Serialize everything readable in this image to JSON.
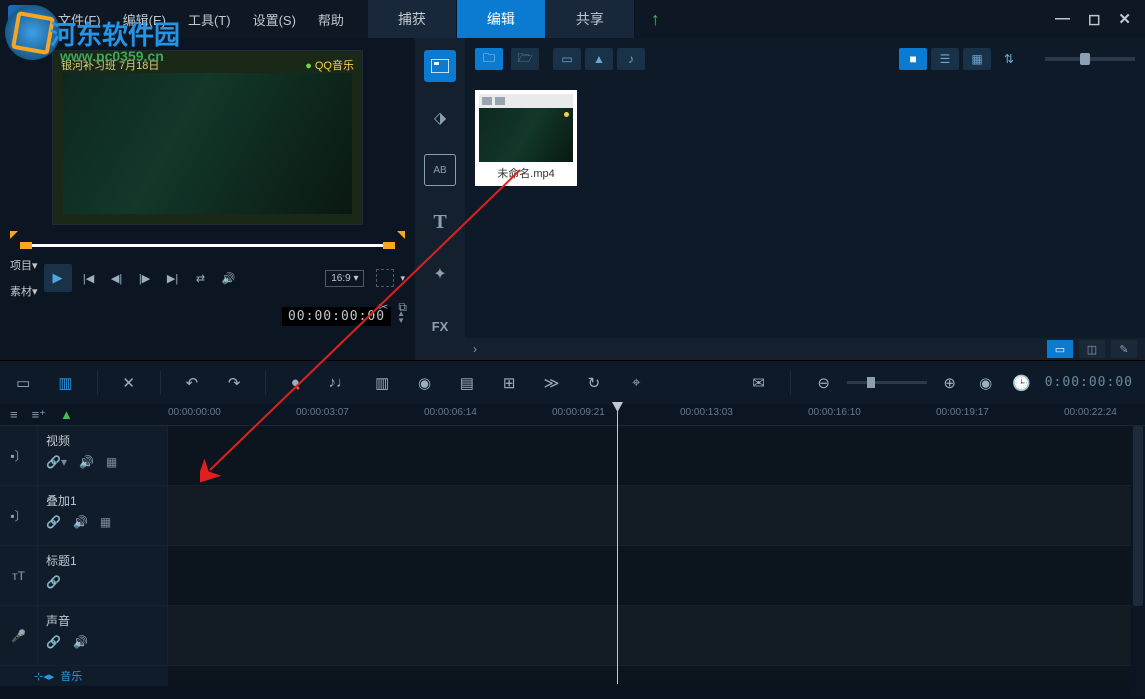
{
  "watermark": {
    "text": "河东软件园",
    "url": "www.pc0359.cn"
  },
  "menu": {
    "file": "文件(F)",
    "edit": "编辑(E)",
    "tools": "工具(T)",
    "settings": "设置(S)",
    "help": "帮助"
  },
  "modes": {
    "capture": "捕获",
    "edit": "编辑",
    "share": "共享"
  },
  "preview": {
    "overlay_text": "银河补习班  7月18日",
    "overlay_music": "QQ音乐",
    "label_project": "项目▾",
    "label_clip": "素材▾",
    "aspect": "16:9 ▾",
    "time": "00:00:00:00"
  },
  "library": {
    "media_name": "未命名.mp4",
    "fx_label": "FX"
  },
  "ruler": {
    "ticks": [
      {
        "pos": 0,
        "label": "00:00:00:00"
      },
      {
        "pos": 128,
        "label": "00:00:03:07"
      },
      {
        "pos": 256,
        "label": "00:00:06:14"
      },
      {
        "pos": 384,
        "label": "00:00:09:21"
      },
      {
        "pos": 512,
        "label": "00:00:13:03"
      },
      {
        "pos": 640,
        "label": "00:00:16:10"
      },
      {
        "pos": 768,
        "label": "00:00:19:17"
      },
      {
        "pos": 896,
        "label": "00:00:22:24"
      }
    ]
  },
  "timeline": {
    "time": "0:00:00:00"
  },
  "tracks": {
    "video": "视频",
    "overlay": "叠加1",
    "title": "标题1",
    "audio": "声音",
    "music": "音乐"
  },
  "icons": {
    "link": "🔗",
    "mute": "🔊",
    "grid": "▦",
    "chevdown": "▾"
  }
}
